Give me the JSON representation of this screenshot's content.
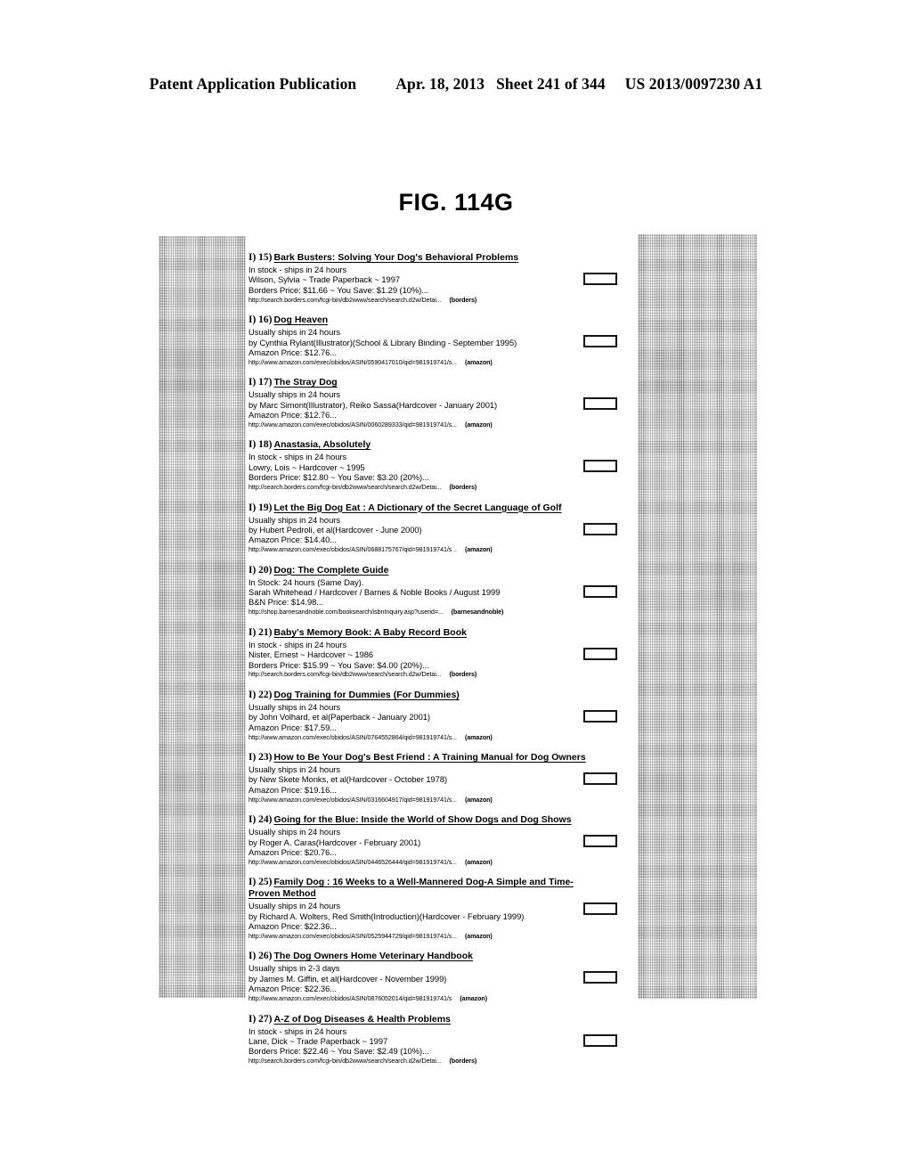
{
  "header": {
    "publication": "Patent Application Publication",
    "date": "Apr. 18, 2013",
    "sheet": "Sheet 241 of 344",
    "patent_number": "US 2013/0097230 A1"
  },
  "figure": {
    "label": "FIG. 114G"
  },
  "results": [
    {
      "index": "I) 15)",
      "title": "Bark Busters: Solving Your Dog's Behavioral Problems",
      "availability": "In stock - ships in 24 hours",
      "author": "Wilson, Sylvia ~ Trade Paperback ~ 1997",
      "price": "Borders Price: $11.66 ~ You Save: $1.29 (10%)...",
      "url": "http://search.borders.com/fcgi-bin/db2www/search/search.d2w/Detai...",
      "source": "(borders)"
    },
    {
      "index": "I) 16)",
      "title": "Dog Heaven",
      "availability": "Usually ships in 24 hours",
      "author": "by Cynthia Rylant(Illustrator)(School & Library Binding - September 1995)",
      "price": "Amazon Price: $12.76...",
      "url": "http://www.amazon.com/exec/obidos/ASIN/0590417010/qid=981919741/s...",
      "source": "(amazon)"
    },
    {
      "index": "I) 17)",
      "title": "The Stray Dog",
      "availability": "Usually ships in 24 hours",
      "author": "by Marc Simont(Illustrator), Reiko Sassa(Hardcover - January 2001)",
      "price": "Amazon Price: $12.76...",
      "url": "http://www.amazon.com/exec/obidos/ASIN/0060289333/qid=981919741/s...",
      "source": "(amazon)"
    },
    {
      "index": "I) 18)",
      "title": "Anastasia, Absolutely",
      "availability": "In stock - ships in 24 hours",
      "author": "Lowry, Lois ~ Hardcover ~ 1995",
      "price": "Borders Price: $12.80 ~ You Save: $3.20 (20%)...",
      "url": "http://search.borders.com/fcgi-bin/db2www/search/search.d2w/Detai...",
      "source": "(borders)"
    },
    {
      "index": "I) 19)",
      "title": "Let the Big Dog Eat : A Dictionary of the Secret Language of Golf",
      "availability": "Usually ships in 24 hours",
      "author": "by Hubert Pedroli, et al(Hardcover - June 2000)",
      "price": "Amazon Price: $14.40...",
      "url": "http://www.amazon.com/exec/obidos/ASIN/0688175767/qid=981919741/s ..",
      "source": "(amazon)"
    },
    {
      "index": "I) 20)",
      "title": "Dog: The Complete Guide",
      "availability": "In Stock: 24 hours (Same Day).",
      "author": "Sarah Whitehead / Hardcover / Barnes & Noble Books / August 1999",
      "price": "B&N Price: $14.98...",
      "url": "http://shop.barnesandnoble.com/booksearch/isbnInquiry.asp?userid=...",
      "source": "(barnesandnoble)"
    },
    {
      "index": "I) 21)",
      "title": "Baby's Memory Book: A Baby Record Book",
      "availability": "In stock - ships in 24 hours",
      "author": "Nister, Ernest ~ Hardcover ~ 1986",
      "price": "Borders Price: $15.99 ~ You Save: $4.00 (20%)...",
      "url": "http://search.borders.com/fcgi-bin/db2www/search/search.d2w/Detai...",
      "source": "(borders)"
    },
    {
      "index": "I) 22)",
      "title": "Dog Training for Dummies (For Dummies)",
      "availability": "Usually ships in 24 hours",
      "author": "by John Volhard, et al(Paperback - January 2001)",
      "price": "Amazon Price: $17.59...",
      "url": "http://www.amazon.com/exec/obidos/ASIN/0764552864/qid=981919741/s...",
      "source": "(amazon)"
    },
    {
      "index": "I) 23)",
      "title": "How to Be Your Dog's Best Friend : A Training Manual for Dog Owners",
      "availability": "Usually ships in 24 hours",
      "author": "by New Skete Monks, et al(Hardcover - October 1978)",
      "price": "Amazon Price: $19.16...",
      "url": "http://www.amazon.com/exec/obidos/ASIN/0316604917/qid=981919741/s...",
      "source": "(amazon)"
    },
    {
      "index": "I) 24)",
      "title": "Going for the Blue: Inside the World of Show Dogs and Dog Shows",
      "availability": "Usually ships in 24 hours",
      "author": "by Roger A. Caras(Hardcover - February 2001)",
      "price": "Amazon Price: $20.76...",
      "url": "http://www.amazon.com/exec/obidos/ASIN/0446526444/qid=981919741/s...",
      "source": "(amazon)"
    },
    {
      "index": "I) 25)",
      "title": "Family Dog : 16 Weeks to a Well-Mannered Dog-A Simple and Time-Proven Method",
      "availability": "Usually ships in 24 hours",
      "author": "by Richard A. Wolters, Red Smith(Introduction)(Hardcover - February 1999)",
      "price": "Amazon Price: $22.36...",
      "url": "http://www.amazon.com/exec/obidos/ASIN/0525944729/qid=981919741/s...",
      "source": "(amazon)"
    },
    {
      "index": "I) 26)",
      "title": "The Dog Owners Home Veterinary Handbook",
      "availability": "Usually ships in 2-3 days",
      "author": "by James M. Giffin, et al(Hardcover - November 1999)",
      "price": "Amazon Price: $22.36...",
      "url": "http://www.amazon.com/exec/obidos/ASIN/0876052014/qid=981919741/s",
      "source": "(amazon)"
    },
    {
      "index": "I) 27)",
      "title": "A-Z of Dog Diseases & Health Problems",
      "availability": "In stock - ships in 24 hours",
      "author": "Lane, Dick ~ Trade Paperback ~ 1997",
      "price": "Borders Price: $22.46 ~ You Save: $2.49 (10%)...",
      "url": "http://search.borders.com/fcgi-bin/db2www/search/search.d2w/Detai...",
      "source": "(borders)"
    }
  ]
}
